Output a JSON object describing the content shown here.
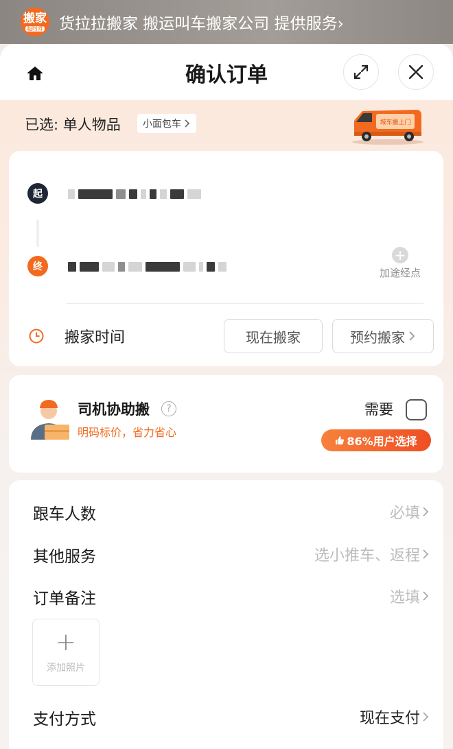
{
  "banner": {
    "logo_main": "搬家",
    "logo_sub": "超时阵",
    "text": "货拉拉搬家 搬运叫车搬家公司 提供服务",
    "chevron": "›"
  },
  "header": {
    "title": "确认订单"
  },
  "selection": {
    "label": "已选: 单人物品",
    "vehicle_tag": "小面包车",
    "van_slogan": "城车搬上门"
  },
  "address": {
    "start_badge": "起",
    "end_badge": "终",
    "waypoint_label": "加途经点"
  },
  "moving_time": {
    "label": "搬家时间",
    "now_label": "现在搬家",
    "book_label": "预约搬家"
  },
  "driver_help": {
    "title": "司机协助搬",
    "help_mark": "?",
    "subtitle": "明码标价，省力省心",
    "need_label": "需要",
    "badge": "86%用户选择"
  },
  "form": {
    "rows": [
      {
        "label": "跟车人数",
        "value": "必填"
      },
      {
        "label": "其他服务",
        "value": "选小推车、返程"
      },
      {
        "label": "订单备注",
        "value": "选填"
      },
      {
        "label": "支付方式",
        "value": "现在支付"
      }
    ],
    "photo_label": "添加照片"
  },
  "colors": {
    "accent": "#f26a1f",
    "dark_badge": "#1f2736"
  }
}
